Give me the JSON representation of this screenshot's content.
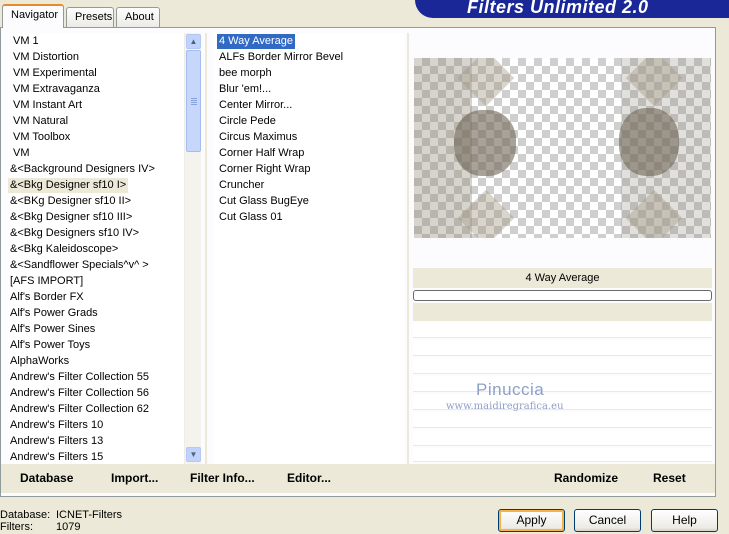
{
  "tabs": [
    {
      "label": "Navigator",
      "active": true
    },
    {
      "label": "Presets",
      "active": false
    },
    {
      "label": "About",
      "active": false
    }
  ],
  "banner": {
    "title": "Filters Unlimited 2.0",
    "color": "#1a2796"
  },
  "categories": {
    "items": [
      "VM 1",
      "VM Distortion",
      "VM Experimental",
      "VM Extravaganza",
      "VM Instant Art",
      "VM Natural",
      "VM Toolbox",
      "VM",
      "&<Background Designers IV>",
      "&<Bkg Designer sf10 I>",
      "&<BKg Designer sf10 II>",
      "&<Bkg Designer sf10 III>",
      "&<Bkg Designers sf10 IV>",
      "&<Bkg Kaleidoscope>",
      "&<Sandflower Specials^v^ >",
      "[AFS IMPORT]",
      "Alf's Border FX",
      "Alf's Power Grads",
      "Alf's Power Sines",
      "Alf's Power Toys",
      "AlphaWorks",
      "Andrew's Filter Collection 55",
      "Andrew's Filter Collection 56",
      "Andrew's Filter Collection 62",
      "Andrew's Filters 10",
      "Andrew's Filters 13",
      "Andrew's Filters 15"
    ],
    "selected": "&<Bkg Designer sf10 I>"
  },
  "filters": {
    "items": [
      "4 Way Average",
      "ALFs Border Mirror Bevel",
      "bee morph",
      "Blur 'em!...",
      "Center Mirror...",
      "Circle Pede",
      "Circus Maximus",
      "Corner Half Wrap",
      "Corner Right Wrap",
      "Cruncher",
      "Cut Glass  BugEye",
      "Cut Glass 01"
    ],
    "selected": "4 Way Average"
  },
  "preview": {
    "filter_name": "4 Way Average",
    "progress": 0
  },
  "watermark": {
    "name": "Pinuccia",
    "url": "www.maidiregrafica.eu"
  },
  "bottom_links": {
    "database": "Database",
    "import": "Import...",
    "filter_info": "Filter Info...",
    "editor": "Editor...",
    "randomize": "Randomize",
    "reset": "Reset"
  },
  "status": {
    "database_label": "Database:",
    "database_value": "ICNET-Filters",
    "filters_label": "Filters:",
    "filters_value": "1079"
  },
  "buttons": {
    "apply": "Apply",
    "cancel": "Cancel",
    "help": "Help"
  }
}
